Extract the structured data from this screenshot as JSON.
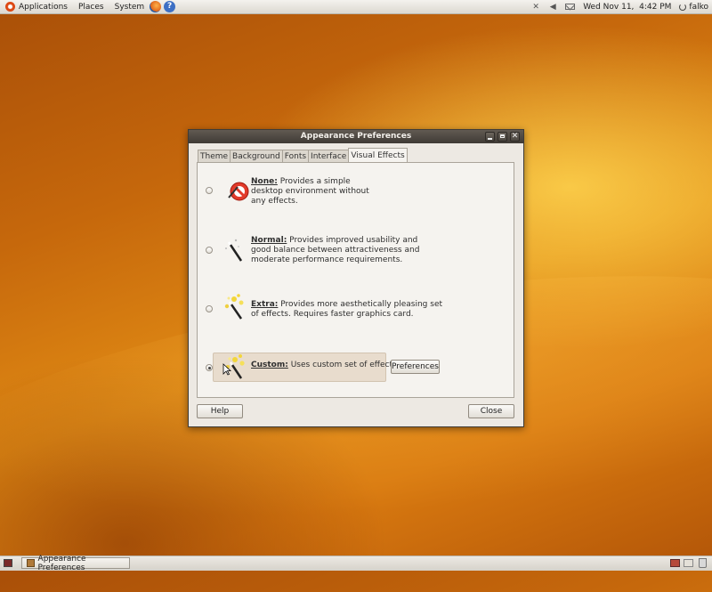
{
  "top_panel": {
    "menus": [
      "Applications",
      "Places",
      "System"
    ],
    "datetime": "Wed Nov 11,  4:42 PM",
    "user": "falko",
    "tray_icons": [
      "network-icon",
      "volume-icon",
      "mail-icon"
    ]
  },
  "window": {
    "title": "Appearance Preferences",
    "tabs": [
      "Theme",
      "Background",
      "Fonts",
      "Interface",
      "Visual Effects"
    ],
    "active_tab": "Visual Effects",
    "options": [
      {
        "name": "None:",
        "desc": " Provides a simple desktop environment without any effects.",
        "lines": [
          "Provides a simple",
          "desktop environment without",
          "any effects."
        ],
        "icon": "no-effects-icon",
        "selected": false
      },
      {
        "name": "Normal:",
        "desc_lines": [
          "Provides improved usability and",
          "good balance between attractiveness and",
          "moderate performance requirements."
        ],
        "icon": "wand-icon",
        "selected": false
      },
      {
        "name": "Extra:",
        "desc_lines": [
          "Provides more aesthetically pleasing set",
          "of effects. Requires faster graphics card."
        ],
        "icon": "sparkle-wand-icon",
        "selected": false
      },
      {
        "name": "Custom:",
        "desc_lines": [
          "Uses custom set of effects."
        ],
        "icon": "custom-wand-icon",
        "selected": true
      }
    ],
    "preferences_label": "Preferences",
    "help_label": "Help",
    "close_label": "Close"
  },
  "bottom_panel": {
    "task_label": "Appearance Preferences"
  },
  "colors": {
    "titlebar": "#4f4943",
    "window_bg": "#ede9e3",
    "accent_orange": "#dd4814"
  }
}
